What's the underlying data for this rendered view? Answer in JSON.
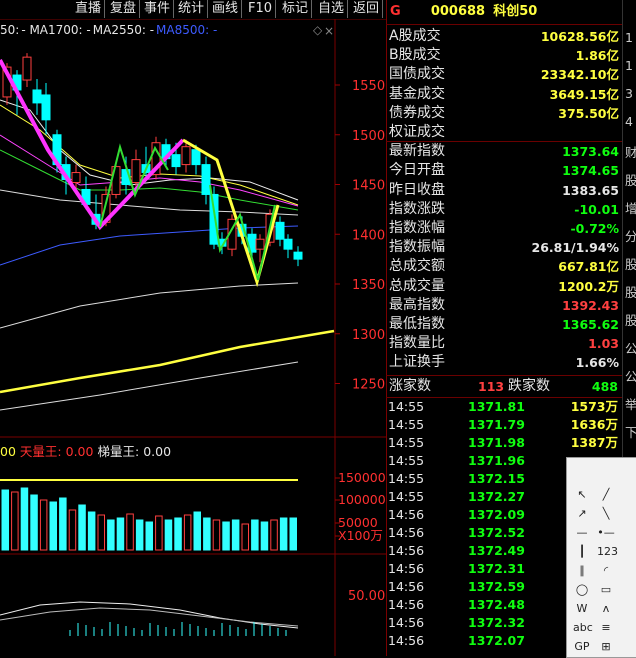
{
  "toolbar": {
    "items": [
      "直播",
      "复盘",
      "事件",
      "统计",
      "画线",
      "F10",
      "标记",
      "自选",
      "返回"
    ]
  },
  "ma_legend": {
    "items": [
      {
        "text": "50:",
        "color": "#e6e6e6"
      },
      {
        "text": "- MA1700: -",
        "color": "#e6e6e6"
      },
      {
        "text": "MA2550: -",
        "color": "#e6e6e6"
      },
      {
        "text": "MA8500: -",
        "color": "#3d5bff"
      }
    ]
  },
  "price_axis": {
    "ticks": [
      "1550",
      "1500",
      "1450",
      "1400",
      "1350",
      "1300",
      "1250"
    ]
  },
  "volume": {
    "legend": [
      {
        "text": "00",
        "color": "#ffff40"
      },
      {
        "text": "天量王:",
        "color": "#ff3030"
      },
      {
        "text": "0.00",
        "color": "#ff3030"
      },
      {
        "text": "梯量王:",
        "color": "#e6e6e6"
      },
      {
        "text": "0.00",
        "color": "#e6e6e6"
      }
    ],
    "axis": [
      "150000",
      "100000",
      "50000",
      "X100万"
    ]
  },
  "indicator_axis": {
    "ticks": [
      "50.00"
    ]
  },
  "header": {
    "g": "G",
    "code": "000688",
    "name": "科创50"
  },
  "stats": [
    {
      "label": "A股成交",
      "value": "10628.56亿",
      "cls": "y"
    },
    {
      "label": "B股成交",
      "value": "1.86亿",
      "cls": "y"
    },
    {
      "label": "国债成交",
      "value": "23342.10亿",
      "cls": "y"
    },
    {
      "label": "基金成交",
      "value": "3649.15亿",
      "cls": "y"
    },
    {
      "label": "债券成交",
      "value": "375.50亿",
      "cls": "y"
    },
    {
      "label": "权证成交",
      "value": "",
      "cls": "y"
    },
    {
      "label": "最新指数",
      "value": "1373.64",
      "cls": "gr"
    },
    {
      "label": "今日开盘",
      "value": "1374.65",
      "cls": "gr"
    },
    {
      "label": "昨日收盘",
      "value": "1383.65",
      "cls": "wh"
    },
    {
      "label": "指数涨跌",
      "value": "-10.01",
      "cls": "gr"
    },
    {
      "label": "指数涨幅",
      "value": "-0.72%",
      "cls": "gr"
    },
    {
      "label": "指数振幅",
      "value": "26.81/1.94%",
      "cls": "wh"
    },
    {
      "label": "总成交额",
      "value": "667.81亿",
      "cls": "y"
    },
    {
      "label": "总成交量",
      "value": "1200.2万",
      "cls": "y"
    },
    {
      "label": "最高指数",
      "value": "1392.43",
      "cls": "rd"
    },
    {
      "label": "最低指数",
      "value": "1365.62",
      "cls": "gr"
    },
    {
      "label": "指数量比",
      "value": "1.03",
      "cls": "rd"
    },
    {
      "label": "上证换手",
      "value": "1.66%",
      "cls": "wh"
    }
  ],
  "updown": {
    "up_label": "涨家数",
    "up": "113",
    "down_label": "跌家数",
    "down": "488"
  },
  "ticks": [
    {
      "time": "14:55",
      "price": "1371.81",
      "vol": "1573万"
    },
    {
      "time": "14:55",
      "price": "1371.79",
      "vol": "1636万"
    },
    {
      "time": "14:55",
      "price": "1371.98",
      "vol": "1387万"
    },
    {
      "time": "14:55",
      "price": "1371.96",
      "vol": ""
    },
    {
      "time": "14:55",
      "price": "1372.15",
      "vol": ""
    },
    {
      "time": "14:55",
      "price": "1372.27",
      "vol": ""
    },
    {
      "time": "14:56",
      "price": "1372.09",
      "vol": ""
    },
    {
      "time": "14:56",
      "price": "1372.52",
      "vol": ""
    },
    {
      "time": "14:56",
      "price": "1372.49",
      "vol": ""
    },
    {
      "time": "14:56",
      "price": "1372.31",
      "vol": ""
    },
    {
      "time": "14:56",
      "price": "1372.59",
      "vol": ""
    },
    {
      "time": "14:56",
      "price": "1372.48",
      "vol": ""
    },
    {
      "time": "14:56",
      "price": "1372.32",
      "vol": ""
    },
    {
      "time": "14:56",
      "price": "1372.07",
      "vol": ""
    }
  ],
  "edge": [
    "1",
    "1",
    "3",
    "4",
    "财",
    "股",
    "增",
    "分",
    "股",
    "股",
    "股",
    "公",
    "公",
    "举",
    "下"
  ],
  "draw_tools": [
    "arrow-icon",
    "line-icon",
    "ray-icon",
    "segment-icon",
    "h-line-icon",
    "dot-line-icon",
    "v-line-icon",
    "123-icon",
    "parallel-icon",
    "arc-icon",
    "ellipse-icon",
    "rect-icon",
    "wave-icon",
    "peak-icon",
    "abc-icon",
    "fib-icon",
    "gp-icon",
    "gann-icon"
  ],
  "colors": {
    "up": "#ff4040",
    "down": "#00ffff",
    "zigzag_pink": "#ff33ff",
    "zigzag_yellow": "#ffff40",
    "zigzag_green": "#33dd33"
  }
}
